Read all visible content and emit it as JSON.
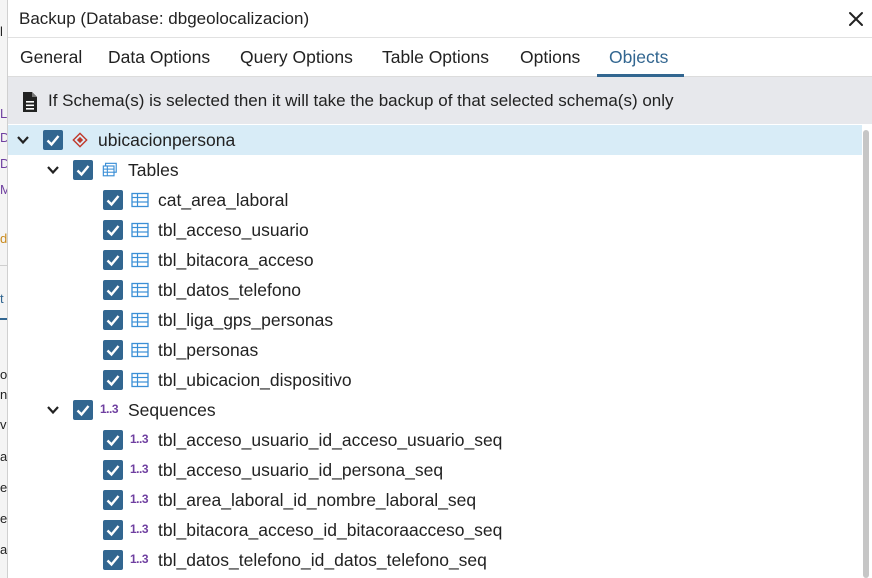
{
  "dialog": {
    "title": "Backup (Database: dbgeolocalizacion)",
    "close_icon": "close-icon"
  },
  "tabs": [
    {
      "label": "General",
      "active": false
    },
    {
      "label": "Data Options",
      "active": false
    },
    {
      "label": "Query Options",
      "active": false
    },
    {
      "label": "Table Options",
      "active": false
    },
    {
      "label": "Options",
      "active": false
    },
    {
      "label": "Objects",
      "active": true
    }
  ],
  "info": {
    "icon": "document-icon",
    "text": "If Schema(s) is selected then it will take the backup of that selected schema(s) only"
  },
  "tree": {
    "schema": {
      "label": "ubicacionpersona",
      "icon": "schema-icon",
      "checked": true,
      "expanded": true
    },
    "tables_group": {
      "label": "Tables",
      "icon": "tables-icon",
      "checked": true,
      "expanded": true,
      "items": [
        {
          "label": "cat_area_laboral",
          "checked": true
        },
        {
          "label": "tbl_acceso_usuario",
          "checked": true
        },
        {
          "label": "tbl_bitacora_acceso",
          "checked": true
        },
        {
          "label": "tbl_datos_telefono",
          "checked": true
        },
        {
          "label": "tbl_liga_gps_personas",
          "checked": true
        },
        {
          "label": "tbl_personas",
          "checked": true
        },
        {
          "label": "tbl_ubicacion_dispositivo",
          "checked": true
        }
      ]
    },
    "sequences_group": {
      "label": "Sequences",
      "icon_text": "1..3",
      "checked": true,
      "expanded": true,
      "items": [
        {
          "label": "tbl_acceso_usuario_id_acceso_usuario_seq",
          "checked": true
        },
        {
          "label": "tbl_acceso_usuario_id_persona_seq",
          "checked": true
        },
        {
          "label": "tbl_area_laboral_id_nombre_laboral_seq",
          "checked": true
        },
        {
          "label": "tbl_bitacora_acceso_id_bitacoraacceso_seq",
          "checked": true
        },
        {
          "label": "tbl_datos_telefono_id_datos_telefono_seq",
          "checked": true
        }
      ]
    }
  },
  "colors": {
    "accent": "#326690",
    "selected_row": "#d8ecf7",
    "info_bar": "#e7e8ec",
    "schema_icon": "#c0392b",
    "sequence_icon": "#6f3fa0",
    "table_icon": "#3b8fd6"
  },
  "background_fragments": [
    "l",
    "L",
    "D",
    "D",
    "M",
    "d",
    "t",
    "o",
    "n",
    "v",
    "a",
    "e",
    "e",
    "a"
  ]
}
